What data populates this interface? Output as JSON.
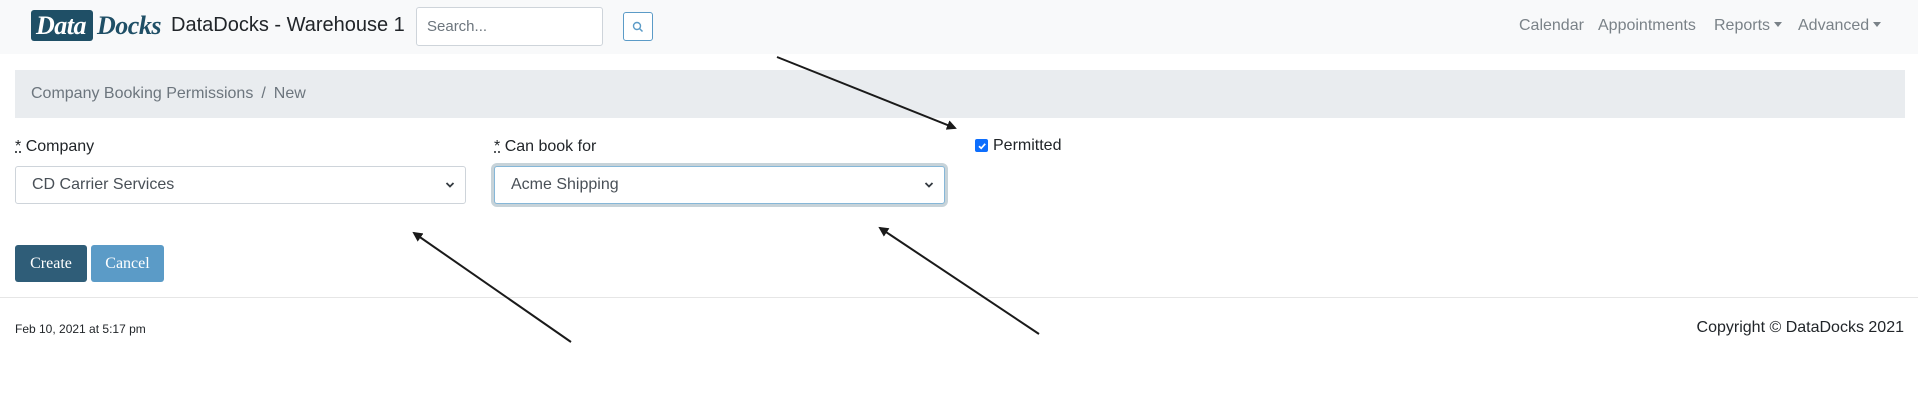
{
  "navbar": {
    "logo_part1": "Data",
    "logo_part2": "Docks",
    "title": "DataDocks - Warehouse 1",
    "search_placeholder": "Search...",
    "links": [
      "Calendar",
      "Appointments",
      "Reports",
      "Advanced"
    ]
  },
  "breadcrumb": {
    "parent": "Company Booking Permissions",
    "separator": "/",
    "current": "New"
  },
  "form": {
    "company_label": "Company",
    "company_value": "CD Carrier Services",
    "can_book_label": "Can book for",
    "can_book_value": "Acme Shipping",
    "required_marker": "*",
    "permitted_label": "Permitted",
    "permitted_checked": true
  },
  "buttons": {
    "create": "Create",
    "cancel": "Cancel"
  },
  "footer": {
    "timestamp": "Feb 10, 2021 at 5:17 pm",
    "copyright": "Copyright © DataDocks 2021"
  },
  "colors": {
    "brand": "#1f4f66",
    "create_button": "#2f5d78",
    "cancel_button": "#5b9bc7",
    "checkbox": "#0d6efd"
  },
  "icons": [
    "search-icon",
    "chevron-down-icon",
    "checkmark-icon",
    "caret-down-icon",
    "annotation-arrow"
  ]
}
